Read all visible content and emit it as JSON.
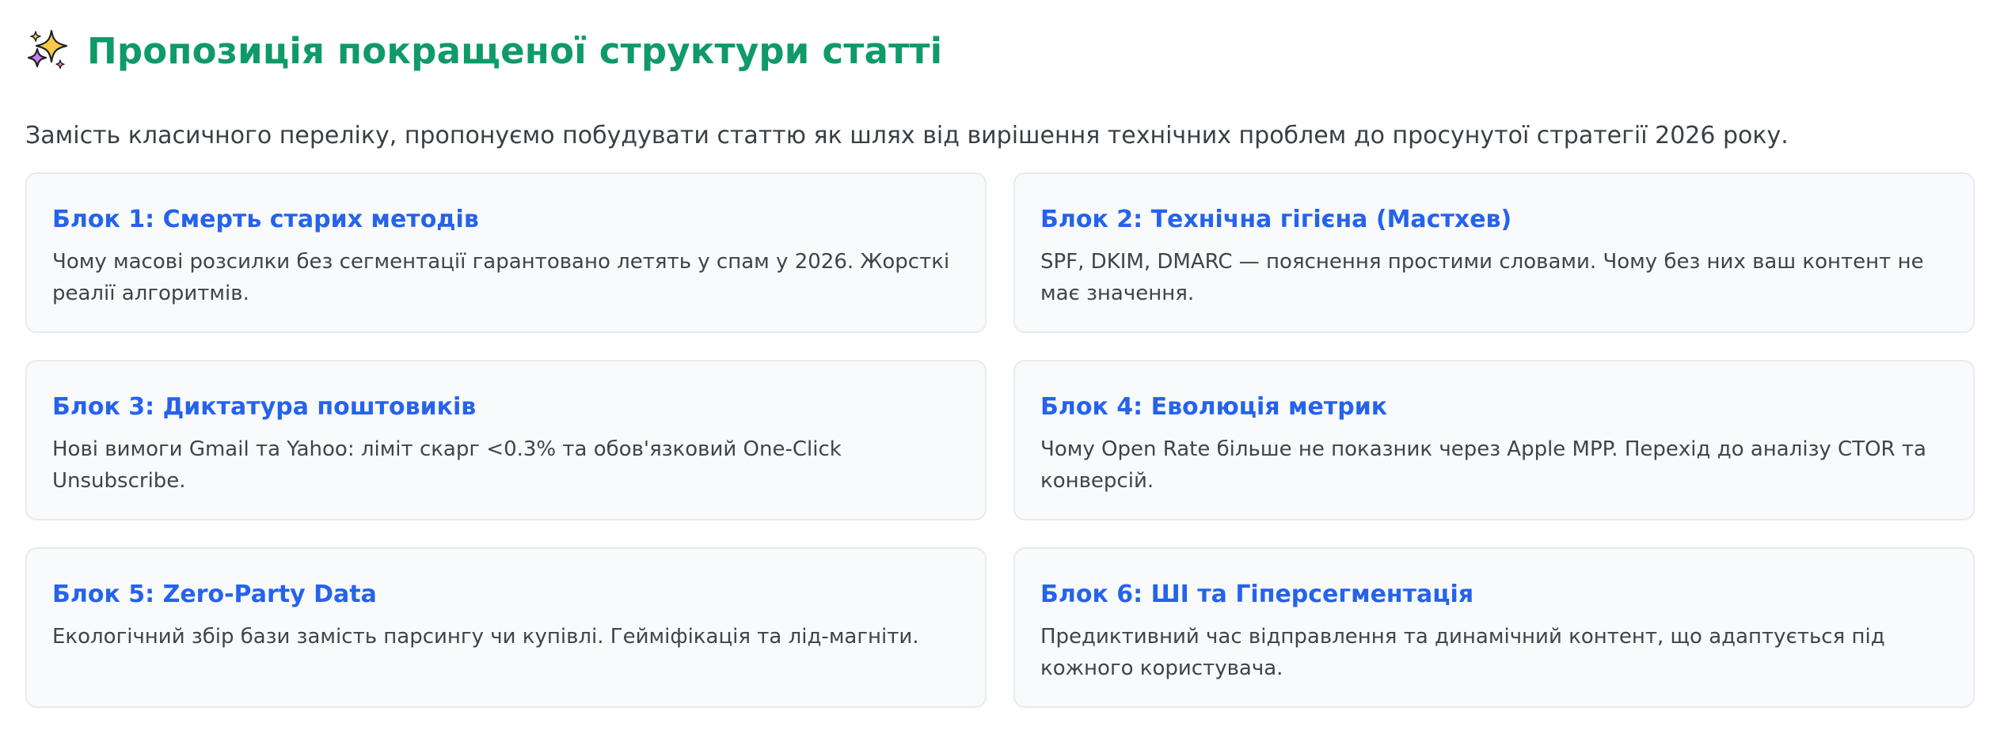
{
  "header": {
    "icon": "sparkles-icon",
    "title": "Пропозиція покращеної структури статті",
    "subtitle": "Замість класичного переліку, пропонуємо побудувати статтю як шлях від вирішення технічних проблем до просунутої стратегії 2026 року."
  },
  "colors": {
    "title": "#0f9a68",
    "card_title": "#2563eb",
    "card_bg": "#f8fafc",
    "card_border": "#e7ebf0"
  },
  "blocks": [
    {
      "title": "Блок 1: Смерть старих методів",
      "text": "Чому масові розсилки без сегментації гарантовано летять у спам у 2026. Жорсткі реалії алгоритмів."
    },
    {
      "title": "Блок 2: Технічна гігієна (Мастхев)",
      "text": "SPF, DKIM, DMARC — пояснення простими словами. Чому без них ваш контент не має значення."
    },
    {
      "title": "Блок 3: Диктатура поштовиків",
      "text": "Нові вимоги Gmail та Yahoo: ліміт скарг <0.3% та обов'язковий One-Click Unsubscribe."
    },
    {
      "title": "Блок 4: Еволюція метрик",
      "text": "Чому Open Rate більше не показник через Apple MPP. Перехід до аналізу CTOR та конверсій."
    },
    {
      "title": "Блок 5: Zero-Party Data",
      "text": "Екологічний збір бази замість парсингу чи купівлі. Гейміфікація та лід-магніти."
    },
    {
      "title": "Блок 6: ШІ та Гіперсегментація",
      "text": "Предиктивний час відправлення та динамічний контент, що адаптується під кожного користувача."
    }
  ]
}
